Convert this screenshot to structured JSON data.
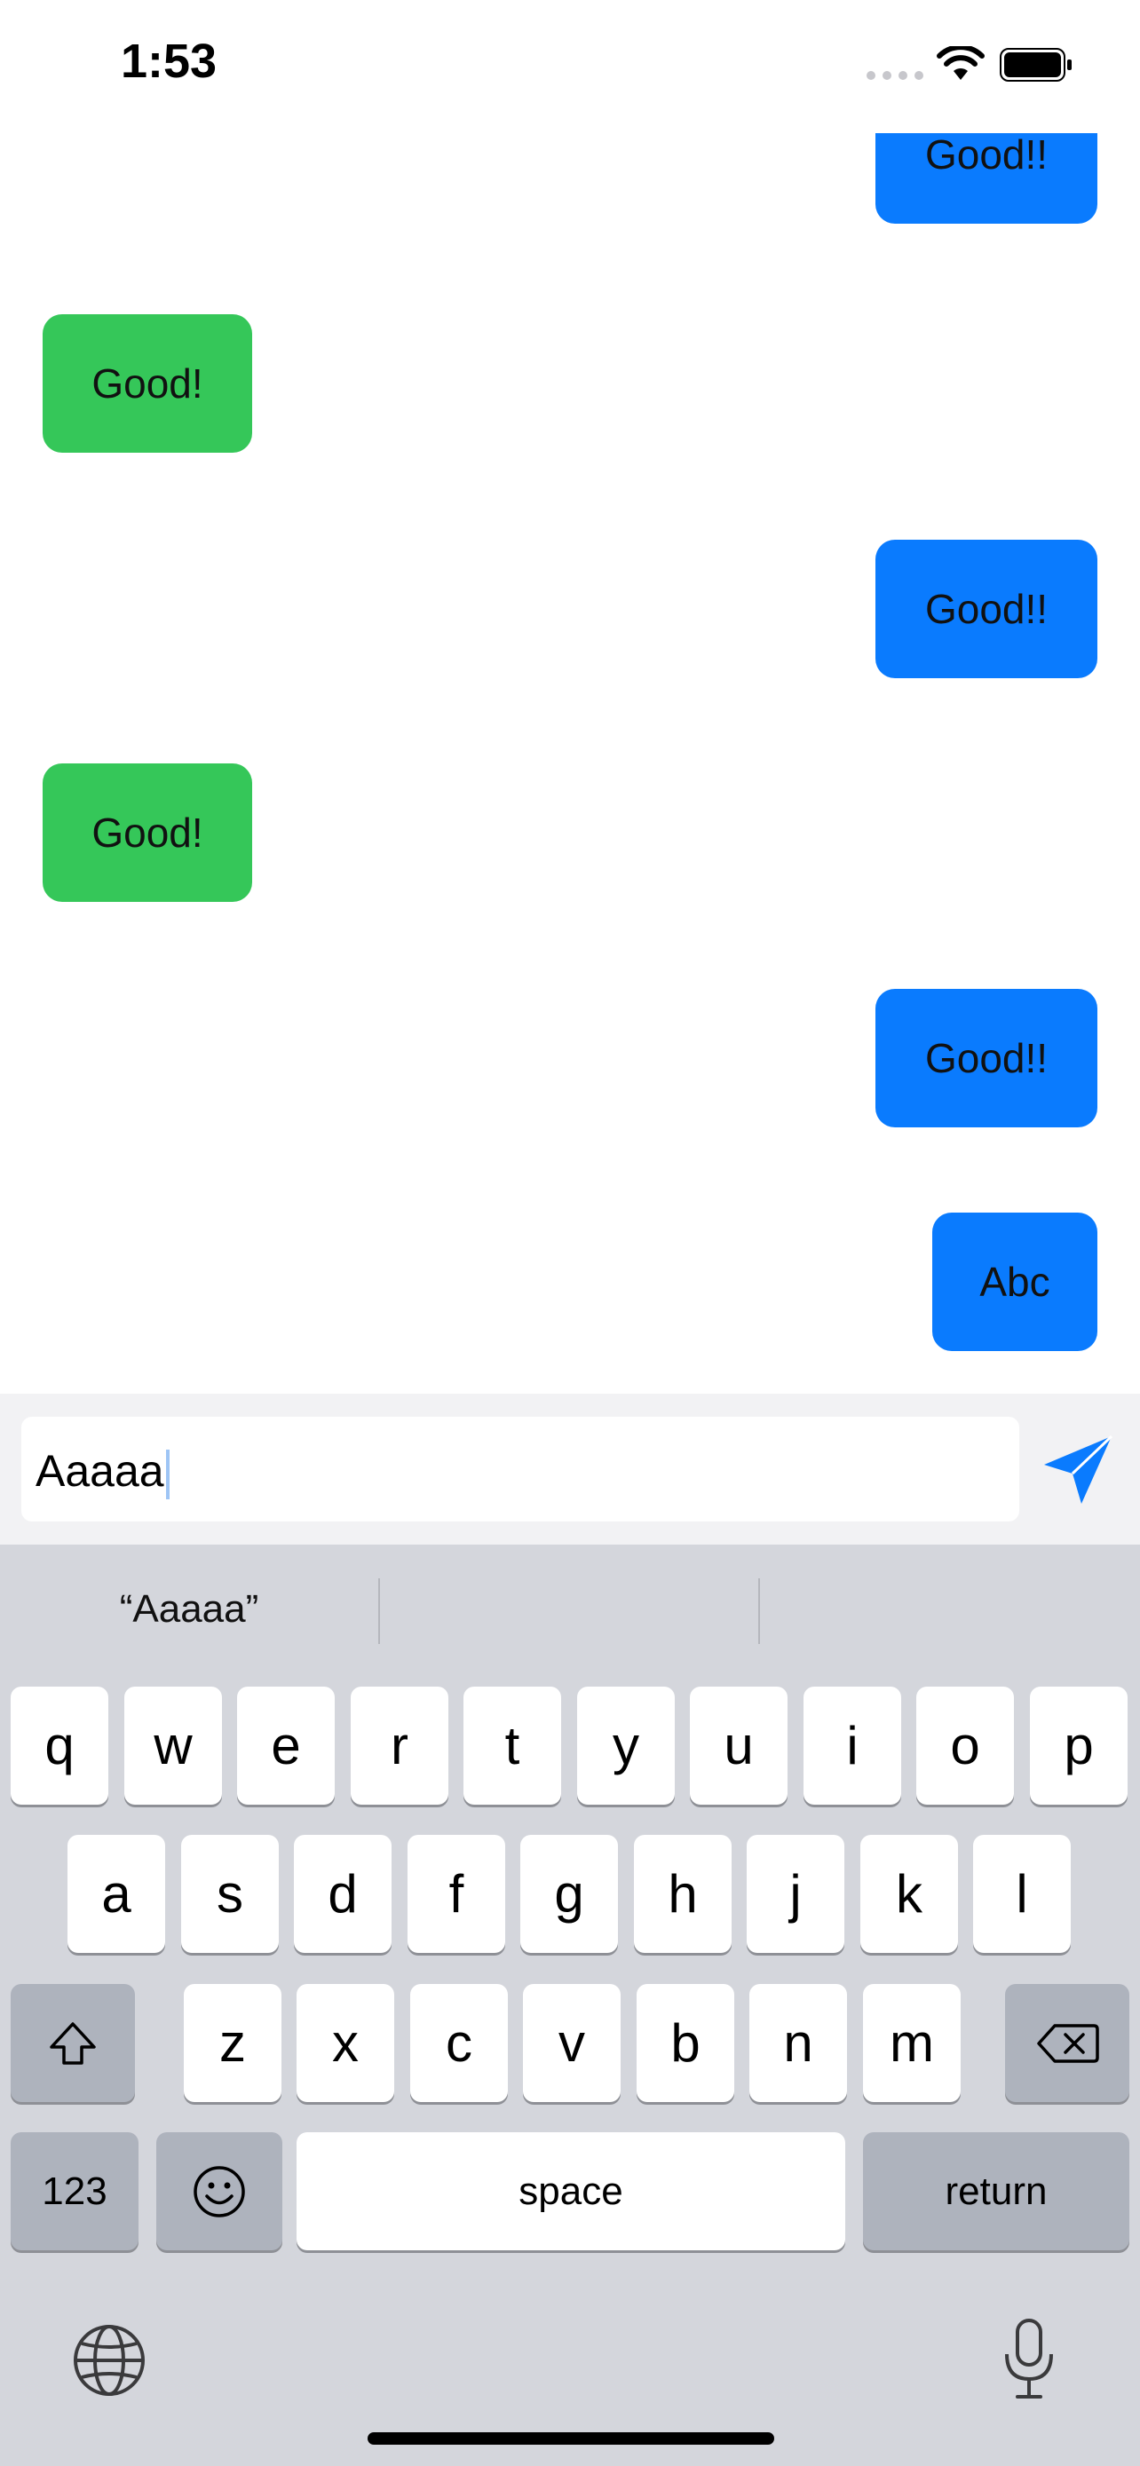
{
  "status_bar": {
    "time": "1:53"
  },
  "messages": [
    {
      "text": "Good!!",
      "sender": "me"
    },
    {
      "text": "Good!",
      "sender": "other"
    },
    {
      "text": "Good!!",
      "sender": "me"
    },
    {
      "text": "Good!",
      "sender": "other"
    },
    {
      "text": "Good!!",
      "sender": "me"
    },
    {
      "text": "Abc",
      "sender": "me"
    }
  ],
  "composer": {
    "value": "Aaaaa"
  },
  "keyboard": {
    "suggestions": [
      "“Aaaaa”",
      "",
      ""
    ],
    "rows": [
      [
        "q",
        "w",
        "e",
        "r",
        "t",
        "y",
        "u",
        "i",
        "o",
        "p"
      ],
      [
        "a",
        "s",
        "d",
        "f",
        "g",
        "h",
        "j",
        "k",
        "l"
      ],
      [
        "z",
        "x",
        "c",
        "v",
        "b",
        "n",
        "m"
      ]
    ],
    "numbers_label": "123",
    "space_label": "space",
    "return_label": "return"
  },
  "colors": {
    "outgoing": "#0a7bfe",
    "incoming": "#35c759",
    "accent": "#0a7bfe"
  },
  "icons": [
    "wifi-icon",
    "battery-icon",
    "send-icon",
    "shift-icon",
    "delete-icon",
    "emoji-icon",
    "globe-icon",
    "microphone-icon"
  ]
}
